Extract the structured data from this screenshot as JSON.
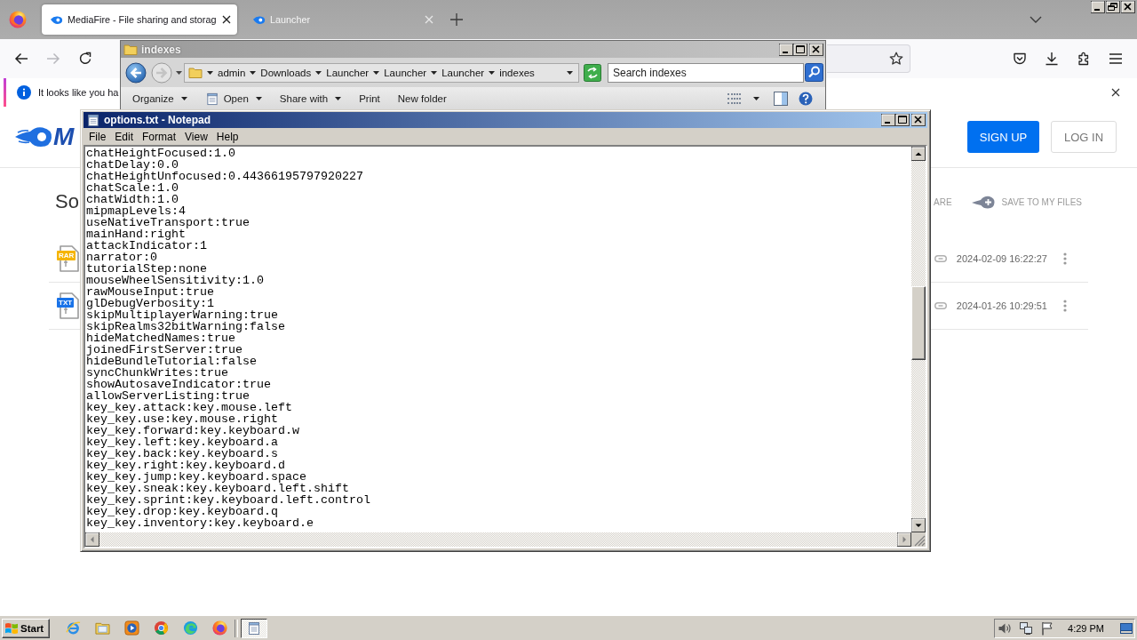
{
  "browser": {
    "tabs": [
      {
        "title": "MediaFire - File sharing and storag",
        "selected": true
      },
      {
        "title": "Launcher",
        "selected": false
      }
    ],
    "forward_disabled": true,
    "notification": "It looks like you ha"
  },
  "page": {
    "logo": "M",
    "heading": "So",
    "header_buttons": [
      {
        "label": "SIGN UP",
        "kind": "primary"
      },
      {
        "label": "LOG IN",
        "kind": "outline"
      }
    ],
    "actions": [
      {
        "label": "ARE",
        "kind": "plain"
      },
      {
        "label": "SAVE TO MY FILES",
        "kind": "icon"
      }
    ],
    "files": [
      {
        "type": "RAR",
        "color": "#f5b400",
        "date": "2024-02-09 16:22:27"
      },
      {
        "type": "TXT",
        "color": "#1a73e8",
        "date": "2024-01-26 10:29:51"
      }
    ]
  },
  "explorer": {
    "title": "indexes",
    "active": false,
    "forward_disabled": true,
    "breadcrumb": [
      "admin",
      "Downloads",
      "Launcher",
      "Launcher",
      "Launcher",
      "indexes"
    ],
    "search": {
      "placeholder": "Search indexes"
    },
    "toolbar": [
      {
        "label": "Organize",
        "kind": "menu"
      },
      {
        "label": "Open",
        "kind": "app"
      },
      {
        "label": "Share with",
        "kind": "menu"
      },
      {
        "label": "Print",
        "kind": "plain"
      },
      {
        "label": "New folder",
        "kind": "plain"
      }
    ]
  },
  "notepad": {
    "title": "options.txt - Notepad",
    "active": true,
    "menu": [
      "File",
      "Edit",
      "Format",
      "View",
      "Help"
    ],
    "lines": [
      "chatHeightFocused:1.0",
      "chatDelay:0.0",
      "chatHeightUnfocused:0.44366195797920227",
      "chatScale:1.0",
      "chatWidth:1.0",
      "mipmapLevels:4",
      "useNativeTransport:true",
      "mainHand:right",
      "attackIndicator:1",
      "narrator:0",
      "tutorialStep:none",
      "mouseWheelSensitivity:1.0",
      "rawMouseInput:true",
      "glDebugVerbosity:1",
      "skipMultiplayerWarning:true",
      "skipRealms32bitWarning:false",
      "hideMatchedNames:true",
      "joinedFirstServer:true",
      "hideBundleTutorial:false",
      "syncChunkWrites:true",
      "showAutosaveIndicator:true",
      "allowServerListing:true",
      "key_key.attack:key.mouse.left",
      "key_key.use:key.mouse.right",
      "key_key.forward:key.keyboard.w",
      "key_key.left:key.keyboard.a",
      "key_key.back:key.keyboard.s",
      "key_key.right:key.keyboard.d",
      "key_key.jump:key.keyboard.space",
      "key_key.sneak:key.keyboard.left.shift",
      "key_key.sprint:key.keyboard.left.control",
      "key_key.drop:key.keyboard.q",
      "key_key.inventory:key.keyboard.e"
    ]
  },
  "taskbar": {
    "start": "Start",
    "tasks": [
      {
        "selected": true
      }
    ],
    "clock": "4:29 PM"
  }
}
